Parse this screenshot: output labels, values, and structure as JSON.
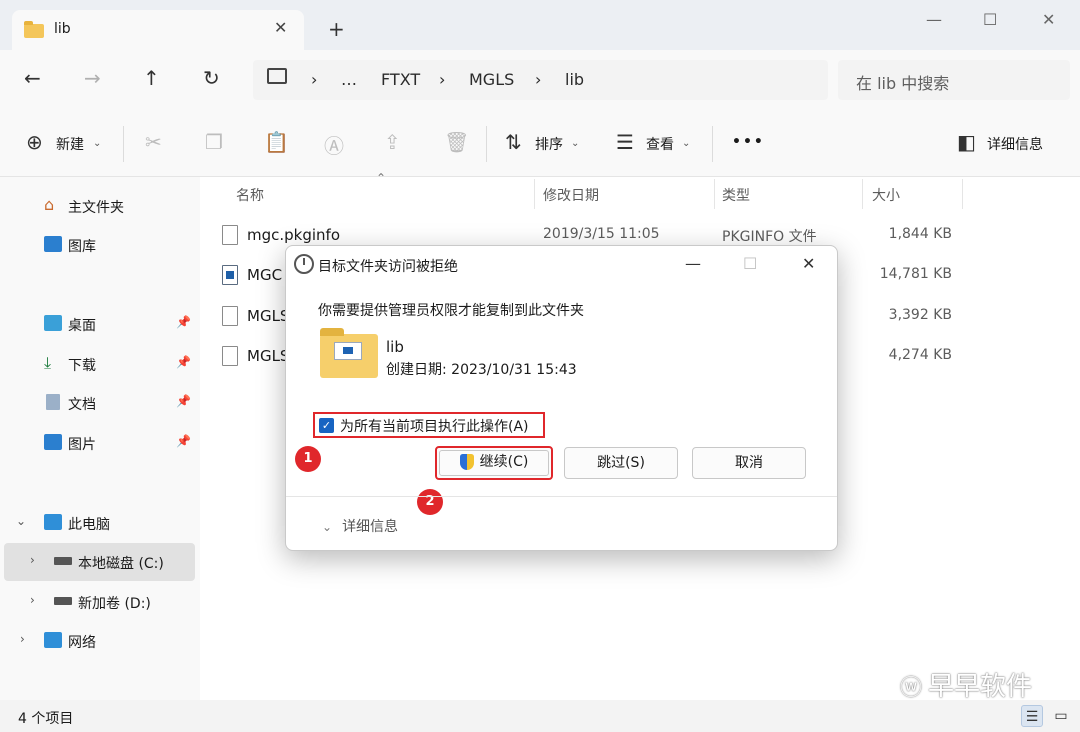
{
  "window": {
    "tab_title": "lib",
    "new_tab": "+",
    "minimize": "—",
    "maximize": "☐",
    "close": "✕"
  },
  "nav": {
    "breadcrumb": [
      "…",
      "FTXT",
      "MGLS",
      "lib"
    ],
    "search_placeholder": "在 lib 中搜索"
  },
  "toolbar": {
    "new_label": "新建",
    "sort_label": "排序",
    "view_label": "查看",
    "more_label": "•••",
    "details_label": "详细信息"
  },
  "sidebar": {
    "items": [
      {
        "label": "主文件夹",
        "icon": "home-icon"
      },
      {
        "label": "图库",
        "icon": "gallery-icon"
      },
      {
        "label": "桌面",
        "icon": "desktop-icon",
        "pinned": true
      },
      {
        "label": "下载",
        "icon": "download-icon",
        "pinned": true
      },
      {
        "label": "文档",
        "icon": "document-icon",
        "pinned": true
      },
      {
        "label": "图片",
        "icon": "pictures-icon",
        "pinned": true
      },
      {
        "label": "此电脑",
        "icon": "computer-icon"
      },
      {
        "label": "本地磁盘 (C:)",
        "icon": "drive-icon",
        "selected": true
      },
      {
        "label": "新加卷 (D:)",
        "icon": "drive-icon"
      },
      {
        "label": "网络",
        "icon": "network-icon"
      }
    ]
  },
  "table": {
    "headers": [
      "名称",
      "修改日期",
      "类型",
      "大小"
    ],
    "rows": [
      {
        "name": "mgc.pkginfo",
        "date": "2019/3/15 11:05",
        "type": "PKGINFO 文件",
        "size": "1,844 KB"
      },
      {
        "name": "MGC",
        "date": "",
        "type": "",
        "size": "14,781 KB"
      },
      {
        "name": "MGLS",
        "date": "",
        "type": "",
        "size": "3,392 KB"
      },
      {
        "name": "MGLS",
        "date": "",
        "type": "",
        "size": "4,274 KB"
      }
    ]
  },
  "status": {
    "item_count": "4 个项目"
  },
  "watermark": "早早软件",
  "dialog": {
    "title": "目标文件夹访问被拒绝",
    "message": "你需要提供管理员权限才能复制到此文件夹",
    "folder_name": "lib",
    "folder_created": "创建日期: 2023/10/31 15:43",
    "checkbox_label": "为所有当前项目执行此操作(A)",
    "checkbox_checked": true,
    "continue_label": "继续(C)",
    "skip_label": "跳过(S)",
    "cancel_label": "取消",
    "details_label": "详细信息",
    "badge_1": "1",
    "badge_2": "2",
    "highlight_color": "#e0272b"
  }
}
